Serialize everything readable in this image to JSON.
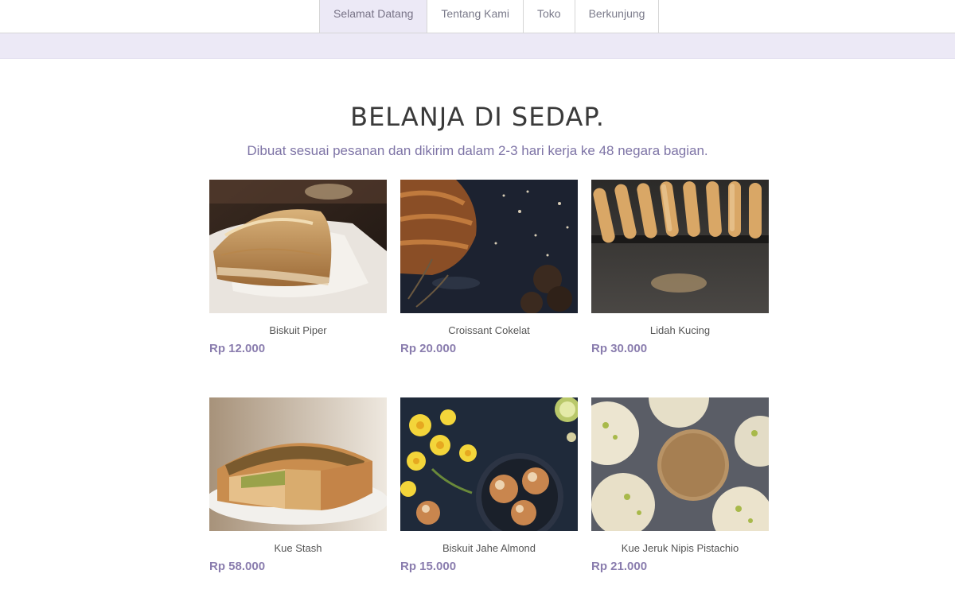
{
  "nav": {
    "tabs": [
      {
        "label": "Selamat Datang",
        "active": true
      },
      {
        "label": "Tentang Kami",
        "active": false
      },
      {
        "label": "Toko",
        "active": false
      },
      {
        "label": "Berkunjung",
        "active": false
      }
    ]
  },
  "shop": {
    "title": "BELANJA DI SEDAP.",
    "subtitle": "Dibuat sesuai pesanan dan dikirim dalam 2-3 hari kerja ke 48 negara bagian.",
    "products": [
      {
        "name": "Biskuit Piper",
        "price": "Rp 12.000",
        "image": "bread-loaf-photo"
      },
      {
        "name": "Croissant Cokelat",
        "price": "Rp 20.000",
        "image": "croissant-photo"
      },
      {
        "name": "Lidah Kucing",
        "price": "Rp 30.000",
        "image": "ladyfinger-cookies-photo"
      },
      {
        "name": "Kue Stash",
        "price": "Rp 58.000",
        "image": "tart-slice-photo"
      },
      {
        "name": "Biskuit Jahe Almond",
        "price": "Rp 15.000",
        "image": "almond-biscuits-photo"
      },
      {
        "name": "Kue Jeruk Nipis Pistachio",
        "price": "Rp 21.000",
        "image": "pistachio-cookies-photo"
      }
    ]
  },
  "colors": {
    "accent": "#8a7dae",
    "band": "#ece9f6"
  }
}
